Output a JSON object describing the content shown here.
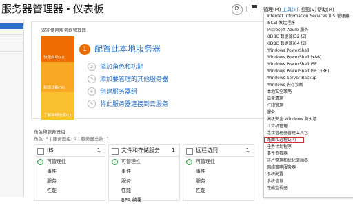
{
  "header": {
    "title": "服务器管理器",
    "separator": "•",
    "subtitle": "仪表板",
    "menu": [
      {
        "label": "管理(M)",
        "active": false
      },
      {
        "label": "工具(T)",
        "active": true
      },
      {
        "label": "视图(V)",
        "active": false
      },
      {
        "label": "帮助(H)",
        "active": false
      }
    ],
    "icons": [
      "refresh-icon",
      "notification-flag-icon"
    ]
  },
  "welcome": {
    "title": "欢迎使用服务器管理器",
    "tiles": [
      "快速启动(Q)",
      "新增功能(W)",
      "了解详细信息(L)"
    ],
    "steps": [
      {
        "num": "1",
        "label": "配置此本地服务器"
      },
      {
        "num": "2",
        "label": "添加角色和功能"
      },
      {
        "num": "3",
        "label": "添加要管理的其他服务器"
      },
      {
        "num": "4",
        "label": "创建服务器组"
      },
      {
        "num": "5",
        "label": "将此服务器连接到云服务"
      }
    ]
  },
  "roles": {
    "title": "角色和服务器组",
    "summary": "角色: 3 | 服务器组: 1 | 服务器总数: 1",
    "cards": [
      {
        "name": "IIS",
        "count": "1",
        "rows": [
          "可管理性",
          "事件",
          "服务",
          "性能"
        ]
      },
      {
        "name": "文件和存储服务",
        "count": "1",
        "rows": [
          "可管理性",
          "事件",
          "服务",
          "性能",
          "BPA 结果"
        ]
      },
      {
        "name": "远程访问",
        "count": "1",
        "rows": [
          "可管理性",
          "事件",
          "服务",
          "性能"
        ]
      }
    ]
  },
  "tools_menu": {
    "items": [
      "Internet Information Services (IIS)管理器",
      "iSCSI 发起程序",
      "Microsoft Azure 服务",
      "ODBC 数据源(32 位)",
      "ODBC 数据源(64 位)",
      "Windows PowerShell",
      "Windows PowerShell (x86)",
      "Windows PowerShell ISE",
      "Windows PowerShell ISE (x86)",
      "Windows Server Backup",
      "Windows 内存诊断",
      "本地安全策略",
      "磁盘清理",
      "打印管理",
      "服务",
      "高级安全 Windows 防火墙",
      "计算机管理",
      "连接管理器管理工具包",
      "路由和远程访问",
      "任务计划程序",
      "事件查看器",
      "碎片整理和优化驱动器",
      "网络策略服务器",
      "系统配置",
      "系统信息",
      "性能监视器"
    ],
    "highlighted": "路由和远程访问"
  },
  "colors": {
    "accent": "#1e6fd0",
    "quick_start": "#ef6c00",
    "whats_new": "#f9a825",
    "learn_more": "#fbc02d",
    "status_ok": "#2e9a3e",
    "highlight_border": "#d13030"
  }
}
